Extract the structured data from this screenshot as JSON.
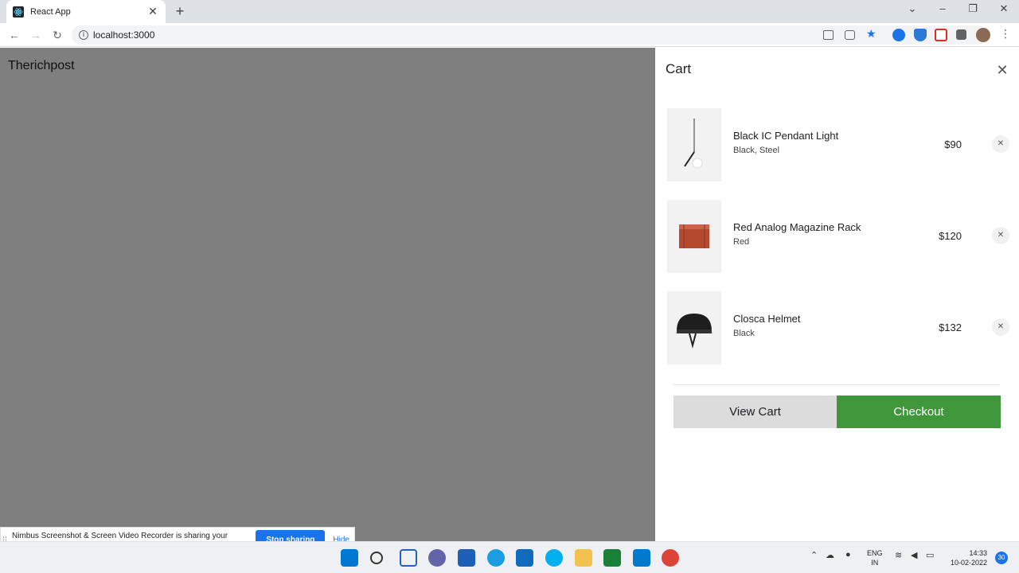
{
  "browser": {
    "tab_title": "React App",
    "url": "localhost:3000"
  },
  "page": {
    "brand": "Therichpost"
  },
  "cart": {
    "title": "Cart",
    "items": [
      {
        "name": "Black IC Pendant Light",
        "variant": "Black, Steel",
        "price": "$90"
      },
      {
        "name": "Red Analog Magazine Rack",
        "variant": "Red",
        "price": "$120"
      },
      {
        "name": "Closca Helmet",
        "variant": "Black",
        "price": "$132"
      }
    ],
    "view_cart_label": "View Cart",
    "checkout_label": "Checkout"
  },
  "share_banner": {
    "text": "Nimbus Screenshot & Screen Video Recorder is sharing your screen.",
    "stop_label": "Stop sharing",
    "hide_label": "Hide"
  },
  "taskbar": {
    "lang_1": "ENG",
    "lang_2": "IN",
    "time": "14:33",
    "date": "10-02-2022",
    "notifications": "30"
  },
  "colors": {
    "checkout_green": "#3f963b",
    "overlay": "#808080",
    "chrome_blue": "#1a73e8"
  }
}
